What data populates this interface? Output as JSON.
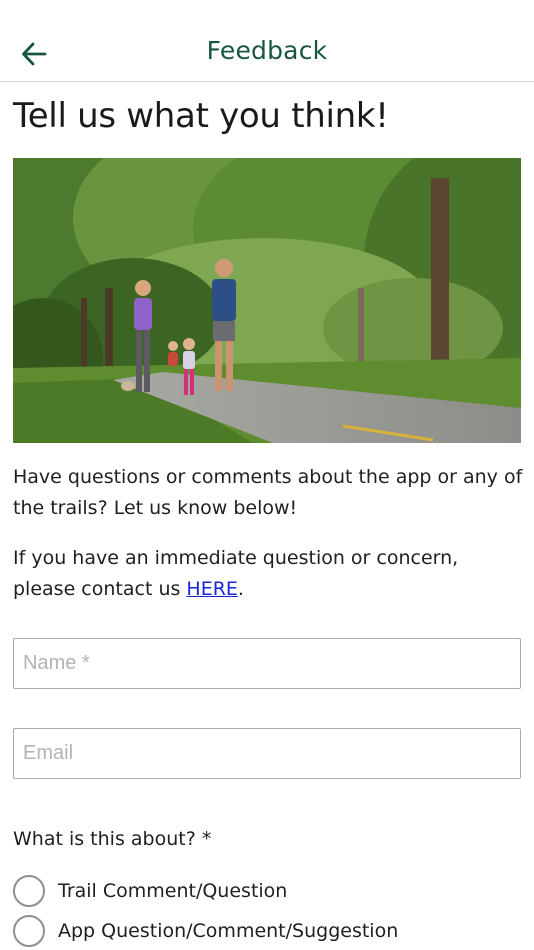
{
  "header": {
    "title": "Feedback",
    "back_icon": "arrow-left-icon",
    "brand_color": "#17573f"
  },
  "heading": "Tell us what you think!",
  "intro": {
    "paragraph1": "Have questions or comments about the app or any of the trails? Let us know below!",
    "paragraph2_prefix": "If you have an immediate question or concern, please contact us ",
    "paragraph2_link": "HERE",
    "paragraph2_suffix": ".",
    "link_color": "#1a25d8"
  },
  "form": {
    "name": {
      "placeholder": "Name *",
      "value": ""
    },
    "email": {
      "placeholder": "Email",
      "value": ""
    },
    "topic_question": "What is this about? *",
    "topic_options": [
      {
        "label": "Trail Comment/Question",
        "selected": false
      },
      {
        "label": "App Question/Comment/Suggestion",
        "selected": false
      }
    ]
  }
}
